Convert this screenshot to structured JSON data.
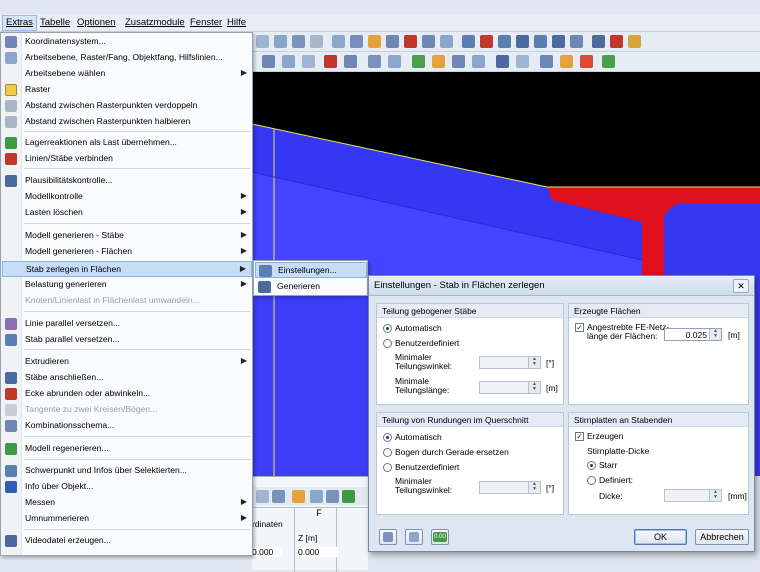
{
  "menubar": {
    "items": [
      "Extras",
      "Tabelle",
      "Optionen",
      "Zusatzmodule",
      "Fenster",
      "Hilfe"
    ]
  },
  "menu": {
    "items": [
      {
        "label": "Koordinatensystem...",
        "icon": "coordinate-system-icon",
        "arrow": false,
        "disabled": false
      },
      {
        "label": "Arbeitsebene, Raster/Fang, Objektfang, Hilfslinien...",
        "icon": "work-plane-icon",
        "arrow": false,
        "disabled": false
      },
      {
        "label": "Arbeitsebene wählen",
        "icon": "",
        "arrow": true,
        "disabled": false
      },
      {
        "label": "Raster",
        "icon": "grid-icon",
        "arrow": false,
        "disabled": false
      },
      {
        "label": "Abstand zwischen Rasterpunkten verdoppeln",
        "icon": "grid-double-icon",
        "arrow": false,
        "disabled": false
      },
      {
        "label": "Abstand zwischen Rasterpunkten halbieren",
        "icon": "grid-half-icon",
        "arrow": false,
        "disabled": false
      },
      {
        "label": "Lagerreaktionen als Last übernehmen...",
        "icon": "support-reactions-icon",
        "arrow": false,
        "disabled": false
      },
      {
        "label": "Linien/Stäbe verbinden",
        "icon": "connect-lines-icon",
        "arrow": false,
        "disabled": false
      },
      {
        "label": "Plausibilitätskontrolle...",
        "icon": "plausibility-icon",
        "arrow": false,
        "disabled": false
      },
      {
        "label": "Modellkontrolle",
        "icon": "",
        "arrow": true,
        "disabled": false
      },
      {
        "label": "Lasten löschen",
        "icon": "",
        "arrow": true,
        "disabled": false
      },
      {
        "label": "Modell generieren - Stäbe",
        "icon": "",
        "arrow": true,
        "disabled": false
      },
      {
        "label": "Modell generieren - Flächen",
        "icon": "",
        "arrow": true,
        "disabled": false
      },
      {
        "label": "Stab zerlegen in Flächen",
        "icon": "",
        "arrow": true,
        "disabled": false
      },
      {
        "label": "Belastung generieren",
        "icon": "",
        "arrow": true,
        "disabled": false
      },
      {
        "label": "Knoten/Linienlast in Flächenlast umwandeln...",
        "icon": "",
        "arrow": false,
        "disabled": true
      },
      {
        "label": "Linie parallel versetzen...",
        "icon": "line-offset-icon",
        "arrow": false,
        "disabled": false
      },
      {
        "label": "Stab parallel versetzen...",
        "icon": "member-offset-icon",
        "arrow": false,
        "disabled": false
      },
      {
        "label": "Extrudieren",
        "icon": "",
        "arrow": true,
        "disabled": false
      },
      {
        "label": "Stäbe anschließen...",
        "icon": "join-members-icon",
        "arrow": false,
        "disabled": false
      },
      {
        "label": "Ecke abrunden oder abwinkeln...",
        "icon": "round-corner-icon",
        "arrow": false,
        "disabled": false
      },
      {
        "label": "Tangente zu zwei Kreisen/Bögen...",
        "icon": "tangent-icon",
        "arrow": false,
        "disabled": true
      },
      {
        "label": "Kombinationsschema...",
        "icon": "combination-icon",
        "arrow": false,
        "disabled": false
      },
      {
        "label": "Modell regenerieren...",
        "icon": "regenerate-icon",
        "arrow": false,
        "disabled": false
      },
      {
        "label": "Schwerpunkt und Infos über Selektierten...",
        "icon": "centroid-icon",
        "arrow": false,
        "disabled": false
      },
      {
        "label": "Info über Objekt...",
        "icon": "info-icon",
        "arrow": false,
        "disabled": false
      },
      {
        "label": "Messen",
        "icon": "",
        "arrow": true,
        "disabled": false
      },
      {
        "label": "Umnummerieren",
        "icon": "",
        "arrow": true,
        "disabled": false
      },
      {
        "label": "Videodatei erzeugen...",
        "icon": "video-icon",
        "arrow": false,
        "disabled": false
      }
    ]
  },
  "submenu": {
    "items": [
      {
        "label": "Einstellungen...",
        "icon": "settings-icon"
      },
      {
        "label": "Generieren",
        "icon": "generate-icon"
      }
    ]
  },
  "dialog": {
    "title": "Einstellungen - Stab in Flächen zerlegen",
    "close": "✕",
    "bent": {
      "title": "Teilung gebogener Stäbe",
      "auto": "Automatisch",
      "user": "Benutzerdefiniert",
      "min_angle_l1": "Minimaler",
      "min_angle_l2": "Teilungswinkel:",
      "min_angle_unit": "[°]",
      "min_len_l1": "Minimale",
      "min_len_l2": "Teilungslänge:",
      "min_len_unit": "[m]"
    },
    "rounding": {
      "title": "Teilung von Rundungen im Querschnitt",
      "auto": "Automatisch",
      "straight": "Bogen durch Gerade ersetzen",
      "user": "Benutzerdefiniert",
      "min_angle_l1": "Minimaler",
      "min_angle_l2": "Teilungswinkel:",
      "min_angle_unit": "[°]"
    },
    "surfaces": {
      "title": "Erzeugte Flächen",
      "check_l1": "Angestrebte FE-Netz-",
      "check_l2": "länge der Flächen:",
      "value": "0.025",
      "unit": "[m]"
    },
    "plates": {
      "title": "Stirnplatten an Stabenden",
      "create": "Erzeugen",
      "thickness": "Stirnplatte-Dicke",
      "rigid": "Starr",
      "defined": "Definiert:",
      "dicke": "Dicke:",
      "unit": "[mm]"
    },
    "buttons": {
      "ok": "OK",
      "cancel": "Abbrechen",
      "units": "0.00"
    }
  },
  "table": {
    "col_f": "F",
    "header": "rdinaten",
    "z_label": "Z [m]",
    "v1": "0.000",
    "v2": "0.000"
  },
  "colors": {
    "accent": "#c6dcf7",
    "surface": "#4040ff",
    "flange": "#e0101e"
  }
}
